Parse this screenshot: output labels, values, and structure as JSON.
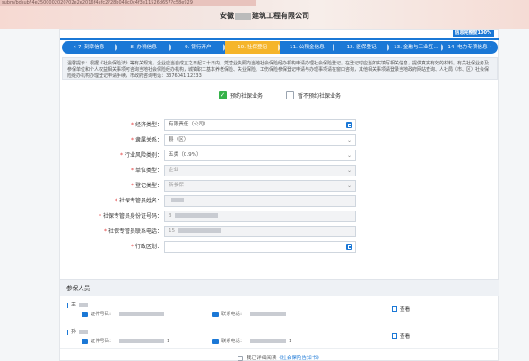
{
  "url": "subm/bdsub?4e2500002020?02e2e2016f4afc2?28b048c0c4f3e11526d657?c58e929",
  "company_name_prefix": "安徽",
  "company_name_suffix": "建筑工程有限公司",
  "progress": {
    "label": "信息完整度100%",
    "value": 100
  },
  "steps": [
    {
      "label": "7. 刻章信息",
      "active": false
    },
    {
      "label": "8. 办税信息",
      "active": false
    },
    {
      "label": "9. 银行开户",
      "active": false
    },
    {
      "label": "10. 社保登记",
      "active": true
    },
    {
      "label": "11. 公积金信息",
      "active": false
    },
    {
      "label": "12. 医保登记",
      "active": false
    },
    {
      "label": "13. 金融与工业互...",
      "active": false
    },
    {
      "label": "14. 电力专项信息",
      "active": false
    }
  ],
  "notice": "温馨提示：根据《社会保险法》等有关规定，企业应当自成立之日起三十日内，凭营业执照向当地社会保险经办机构申请办理社会保险登记。在登记时应当如实填写相关信息，提供真实有效的材料。有关社保业务及参保单位和个人权益相关事项可咨询当地社会保险经办机构，城镇职工基本养老保险、失业保险、工伤保险参保登记申请与办理事项请在窗口咨询，其他相关事项请登录当地政府网站查询、人社局（市、区）社会保险经办机构办理登记申请手续，市政府咨询电话：3376041 12333",
  "choices": {
    "reserve": {
      "label": "预约社保业务",
      "checked": true
    },
    "no_reserve": {
      "label": "暂不预约社保业务",
      "checked": false
    }
  },
  "form": [
    {
      "key": "econ_type",
      "label": "经济类型：",
      "required": true,
      "value": "有限责任（公司）",
      "kind": "lookup",
      "disabled": false
    },
    {
      "key": "affiliation",
      "label": "隶属关系：",
      "required": true,
      "value": "县（区）",
      "kind": "select",
      "disabled": false
    },
    {
      "key": "risk_category",
      "label": "行业风险类别：",
      "required": true,
      "value": "五类（0.9%）",
      "kind": "select",
      "disabled": false
    },
    {
      "key": "unit_type",
      "label": "单位类型：",
      "required": true,
      "value": "企业",
      "kind": "select",
      "disabled": true
    },
    {
      "key": "reg_type",
      "label": "登记类型：",
      "required": true,
      "value": "新参保",
      "kind": "select",
      "disabled": true
    },
    {
      "key": "admin_name",
      "label": "社保专管员姓名：",
      "required": true,
      "value": "",
      "kind": "masked",
      "disabled": true
    },
    {
      "key": "admin_id",
      "label": "社保专管员身份证号码：",
      "required": true,
      "value": "3",
      "kind": "masked",
      "disabled": true
    },
    {
      "key": "admin_phone",
      "label": "社保专管员联系电话：",
      "required": true,
      "value": "15",
      "kind": "masked",
      "disabled": true
    },
    {
      "key": "district",
      "label": "行政区划：",
      "required": true,
      "value": "",
      "kind": "lookup",
      "disabled": false
    }
  ],
  "insured": {
    "title": "参保人员",
    "id_label": "证件号码：",
    "phone_label": "联系电话：",
    "view_label": "查看",
    "people": [
      {
        "name": "王",
        "id_tail": "",
        "phone_tail": ""
      },
      {
        "name": "孙",
        "id_tail": "1",
        "phone_tail": "1"
      }
    ]
  },
  "agree": {
    "prefix": "我已详细阅读",
    "link": "《社会保险告知书》"
  },
  "colors": {
    "primary": "#1b78d6",
    "active_step": "#f5b52b",
    "checked": "#36b24a",
    "required": "#e23b3b"
  }
}
